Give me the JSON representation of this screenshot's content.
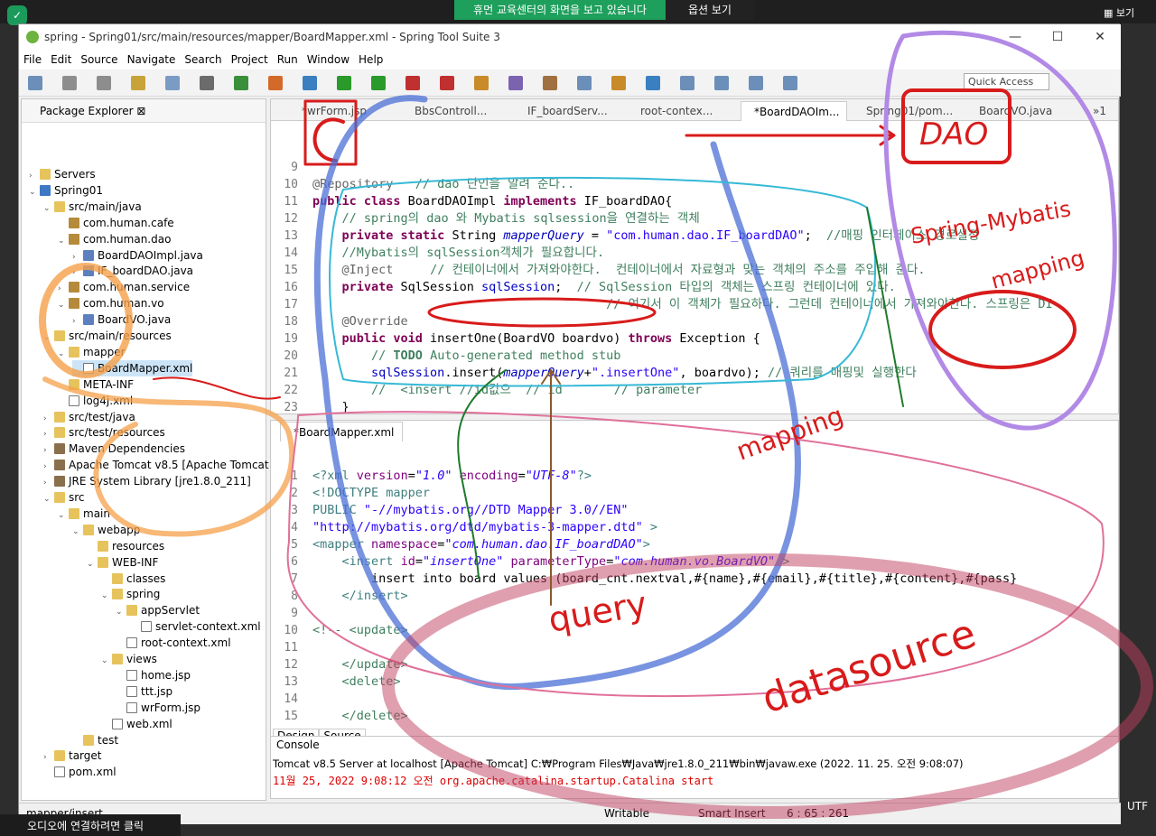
{
  "overlay": {
    "banner": "휴먼 교육센터의 화면을 보고 있습니다",
    "options": "옵션 보기",
    "view": "보기",
    "tooltip": "오디오에 연결하려면 클릭"
  },
  "window": {
    "title": "spring - Spring01/src/main/resources/mapper/BoardMapper.xml - Spring Tool Suite 3",
    "min": "—",
    "max": "☐",
    "close": "✕"
  },
  "menu": [
    "File",
    "Edit",
    "Source",
    "Navigate",
    "Search",
    "Project",
    "Run",
    "Window",
    "Help"
  ],
  "quick_access": "Quick Access",
  "package_explorer": {
    "title": "Package Explorer",
    "tree": [
      {
        "label": "Servers",
        "ind": 0,
        "tw": "›",
        "ico": "i-fold"
      },
      {
        "label": "Spring01",
        "ind": 0,
        "tw": "⌄",
        "ico": "i-proj"
      },
      {
        "label": "src/main/java",
        "ind": 1,
        "tw": "⌄",
        "ico": "i-fold"
      },
      {
        "label": "com.human.cafe",
        "ind": 2,
        "tw": "",
        "ico": "i-pkg"
      },
      {
        "label": "com.human.dao",
        "ind": 2,
        "tw": "⌄",
        "ico": "i-pkg"
      },
      {
        "label": "BoardDAOImpl.java",
        "ind": 3,
        "tw": "›",
        "ico": "i-java"
      },
      {
        "label": "IF_boardDAO.java",
        "ind": 3,
        "tw": "›",
        "ico": "i-java"
      },
      {
        "label": "com.human.service",
        "ind": 2,
        "tw": "›",
        "ico": "i-pkg"
      },
      {
        "label": "com.human.vo",
        "ind": 2,
        "tw": "⌄",
        "ico": "i-pkg"
      },
      {
        "label": "BoardVO.java",
        "ind": 3,
        "tw": "›",
        "ico": "i-java"
      },
      {
        "label": "src/main/resources",
        "ind": 1,
        "tw": "⌄",
        "ico": "i-fold"
      },
      {
        "label": "mapper",
        "ind": 2,
        "tw": "⌄",
        "ico": "i-fold"
      },
      {
        "label": "BoardMapper.xml",
        "ind": 3,
        "tw": "",
        "ico": "i-xml",
        "sel": true
      },
      {
        "label": "META-INF",
        "ind": 2,
        "tw": "",
        "ico": "i-fold"
      },
      {
        "label": "log4j.xml",
        "ind": 2,
        "tw": "",
        "ico": "i-xml"
      },
      {
        "label": "src/test/java",
        "ind": 1,
        "tw": "›",
        "ico": "i-fold"
      },
      {
        "label": "src/test/resources",
        "ind": 1,
        "tw": "›",
        "ico": "i-fold"
      },
      {
        "label": "Maven Dependencies",
        "ind": 1,
        "tw": "›",
        "ico": "i-jar"
      },
      {
        "label": "Apache Tomcat v8.5 [Apache Tomcat v8.5]",
        "ind": 1,
        "tw": "›",
        "ico": "i-jar"
      },
      {
        "label": "JRE System Library [jre1.8.0_211]",
        "ind": 1,
        "tw": "›",
        "ico": "i-jar"
      },
      {
        "label": "src",
        "ind": 1,
        "tw": "⌄",
        "ico": "i-fold"
      },
      {
        "label": "main",
        "ind": 2,
        "tw": "⌄",
        "ico": "i-fold"
      },
      {
        "label": "webapp",
        "ind": 3,
        "tw": "⌄",
        "ico": "i-fold"
      },
      {
        "label": "resources",
        "ind": 4,
        "tw": "",
        "ico": "i-fold"
      },
      {
        "label": "WEB-INF",
        "ind": 4,
        "tw": "⌄",
        "ico": "i-fold"
      },
      {
        "label": "classes",
        "ind": 5,
        "tw": "",
        "ico": "i-fold"
      },
      {
        "label": "spring",
        "ind": 5,
        "tw": "⌄",
        "ico": "i-fold"
      },
      {
        "label": "appServlet",
        "ind": 6,
        "tw": "⌄",
        "ico": "i-fold"
      },
      {
        "label": "servlet-context.xml",
        "ind": 7,
        "tw": "",
        "ico": "i-xml"
      },
      {
        "label": "root-context.xml",
        "ind": 6,
        "tw": "",
        "ico": "i-xml"
      },
      {
        "label": "views",
        "ind": 5,
        "tw": "⌄",
        "ico": "i-fold"
      },
      {
        "label": "home.jsp",
        "ind": 6,
        "tw": "",
        "ico": "i-xml"
      },
      {
        "label": "ttt.jsp",
        "ind": 6,
        "tw": "",
        "ico": "i-xml"
      },
      {
        "label": "wrForm.jsp",
        "ind": 6,
        "tw": "",
        "ico": "i-xml"
      },
      {
        "label": "web.xml",
        "ind": 5,
        "tw": "",
        "ico": "i-xml"
      },
      {
        "label": "test",
        "ind": 3,
        "tw": "",
        "ico": "i-fold"
      },
      {
        "label": "target",
        "ind": 1,
        "tw": "›",
        "ico": "i-fold"
      },
      {
        "label": "pom.xml",
        "ind": 1,
        "tw": "",
        "ico": "i-xml"
      }
    ]
  },
  "editor_tabs": [
    "*wrForm.jsp",
    "BbsControll...",
    "IF_boardServ...",
    "root-contex...",
    "*BoardDAOIm...",
    "Spring01/pom...",
    "BoardVO.java"
  ],
  "tabs_overflow": "»1",
  "java_lines": [
    {
      "n": "9",
      "html": ""
    },
    {
      "n": "10",
      "html": "<span class='ann'>@Repository</span>   <span class='cm'>// dao 단인을 알려 준다..</span>"
    },
    {
      "n": "11",
      "html": "<span class='kw'>public class</span> BoardDAOImpl <span class='kw'>implements</span> IF_boardDAO{"
    },
    {
      "n": "12",
      "html": "    <span class='cm'>// spring의 dao 와 Mybatis sqlsession을 연결하는 객체</span>"
    },
    {
      "n": "13",
      "html": "    <span class='kw'>private static</span> String <span class='it'>mapperQuery</span> = <span class='st'>\"com.human.dao.IF_boardDAO\"</span>;  <span class='cm'>//매핑 인터페이스 경로설정</span>"
    },
    {
      "n": "14",
      "html": "    <span class='cm'>//Mybatis의 sqlSession객체가 필요합니다.</span>"
    },
    {
      "n": "15",
      "html": "    <span class='ann'>@Inject</span>     <span class='cm'>// 컨테이너에서 가져와야한다.  컨테이너에서 자료형과 맞는 객체의 주소를 주입해 준다.</span>"
    },
    {
      "n": "16",
      "html": "    <span class='kw'>private</span> SqlSession <span class='fld'>sqlSession</span>;  <span class='cm'>// SqlSession 타입의 객체는 스프링 컨테이너에 있다.</span>"
    },
    {
      "n": "17",
      "html": "                                        <span class='cm'>// 여기서 이 객체가 필요하다. 그런데 컨테이너에서 가져와야한다. 스프링은 DI</span>"
    },
    {
      "n": "18",
      "html": "    <span class='ann'>@Override</span>"
    },
    {
      "n": "19",
      "html": "    <span class='kw'>public void</span> insertOne(BoardVO boardvo) <span class='kw'>throws</span> Exception {"
    },
    {
      "n": "20",
      "html": "        <span class='cm'>// <b>TODO</b> Auto-generated method stub</span>"
    },
    {
      "n": "21",
      "html": "        <span class='fld'>sqlSession</span>.insert(<span class='it'>mapperQuery</span>+<span class='st'>\".insertOne\"</span>, boardvo); <span class='cm'>// 쿼리를 매핑및 실행한다</span>"
    },
    {
      "n": "22",
      "html": "        <span class='cm'>//  &lt;insert //id값으  // id       // parameter</span>"
    },
    {
      "n": "23",
      "html": "    }"
    }
  ],
  "xml_tab": "*BoardMapper.xml",
  "xml_lines": [
    {
      "n": "1",
      "html": "<span class='xtag'>&lt;?</span><span class='xtag'>xml</span> <span class='xattr'>version</span>=<span class='xval'>\"1.0\"</span> <span class='xattr'>encoding</span>=<span class='xval'>\"UTF-8\"</span><span class='xtag'>?&gt;</span>"
    },
    {
      "n": "2",
      "html": "<span class='xtag'>&lt;!DOCTYPE mapper</span>"
    },
    {
      "n": "3",
      "html": "<span class='xtag'>PUBLIC</span> <span class='st'>\"-//mybatis.org//DTD Mapper 3.0//EN\"</span>"
    },
    {
      "n": "4",
      "html": "<span class='st'>\"http://mybatis.org/dtd/mybatis-3-mapper.dtd\"</span> <span class='xtag'>&gt;</span>"
    },
    {
      "n": "5",
      "html": "<span class='xtag'>&lt;mapper</span> <span class='xattr'>namespace</span>=<span class='xval'>\"com.human.dao.IF_boardDAO\"</span><span class='xtag'>&gt;</span>"
    },
    {
      "n": "6",
      "html": "    <span class='xtag'>&lt;insert</span> <span class='xattr'>id</span>=<span class='xval'>\"insertOne\"</span> <span class='xattr'>parameterType</span>=<span class='xval'>\"com.human.vo.BoardVO\"</span> <span class='xtag'>&gt;</span>"
    },
    {
      "n": "7",
      "html": "        insert into board values (board_cnt.nextval,#{name},#{email},#{title},#{content},#{pass}"
    },
    {
      "n": "8",
      "html": "    <span class='xtag'>&lt;/insert&gt;</span>"
    },
    {
      "n": "9",
      "html": ""
    },
    {
      "n": "10",
      "html": "<span class='cm'>&lt;!-- &lt;update&gt;</span>"
    },
    {
      "n": "11",
      "html": ""
    },
    {
      "n": "12",
      "html": "    <span class='cm'>&lt;/update&gt;</span>"
    },
    {
      "n": "13",
      "html": "    <span class='cm'>&lt;delete&gt;</span>"
    },
    {
      "n": "14",
      "html": ""
    },
    {
      "n": "15",
      "html": "    <span class='cm'>&lt;/delete&gt;</span>"
    }
  ],
  "xml_bottom_tabs": [
    "Design",
    "Source"
  ],
  "console": {
    "title": "Console",
    "server": "Tomcat v8.5 Server at localhost [Apache Tomcat] C:₩Program Files₩Java₩jre1.8.0_211₩bin₩javaw.exe (2022. 11. 25. 오전 9:08:07)",
    "line": "11월 25, 2022 9:08:12 오전 org.apache.catalina.startup.Catalina start"
  },
  "status": {
    "left": "mapper/insert",
    "writable": "Writable",
    "insert": "Smart Insert",
    "pos": "6 : 65 : 261",
    "enc": "UTF"
  },
  "ink_labels": [
    "c",
    "DAO",
    "Spring-Mybatis",
    "mapping",
    "query",
    "datasource",
    "mapping"
  ],
  "ink_colors": {
    "red": "#d81b1b",
    "blue": "#4b6fd6",
    "orange": "#f5a04a",
    "purple": "#b28ae6",
    "green": "#1e7a2a",
    "pink": "#e0709a"
  }
}
